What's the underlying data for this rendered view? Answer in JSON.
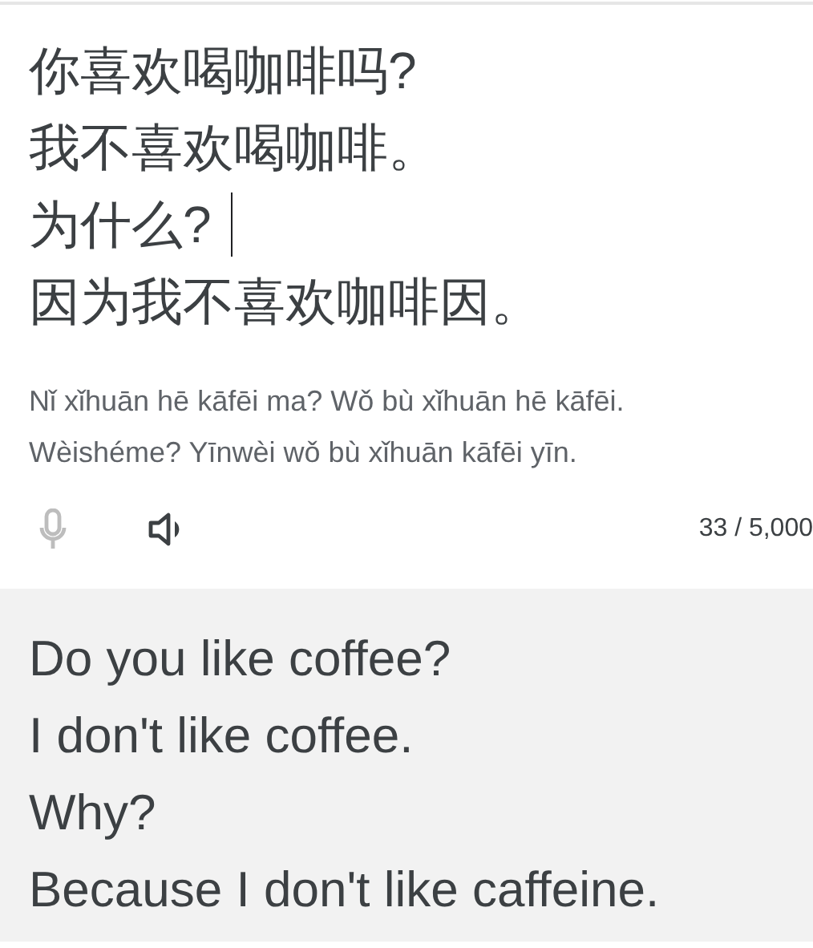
{
  "source": {
    "lines": [
      {
        "text": "你喜欢喝咖啡吗?",
        "caret": false
      },
      {
        "text": "我不喜欢喝咖啡。",
        "caret": false
      },
      {
        "text": "为什么?",
        "caret": true
      },
      {
        "text": "因为我不喜欢咖啡因。",
        "caret": false
      }
    ],
    "romanization": "Nǐ xǐhuān hē kāfēi ma? Wǒ bù xǐhuān hē kāfēi. Wèishéme? Yīnwèi wǒ bù xǐhuān kāfēi yīn.",
    "mic": {
      "disabled": true
    },
    "char_count": "33 / 5,000"
  },
  "translation": {
    "lines": [
      "Do you like coffee?",
      "I don't like coffee.",
      "Why?",
      "Because I don't like caffeine."
    ]
  }
}
